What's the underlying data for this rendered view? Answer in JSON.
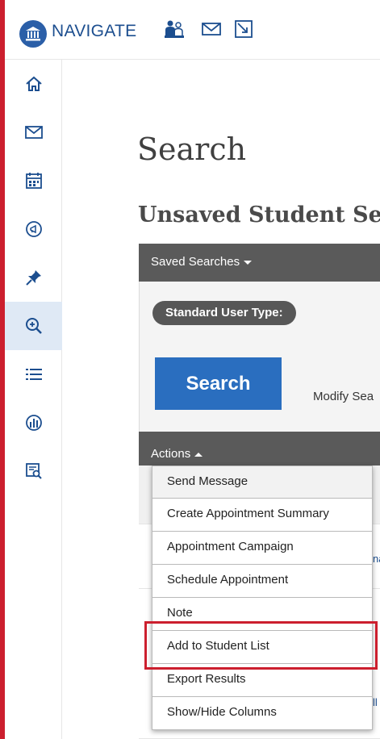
{
  "app": {
    "logo_text": "NAVIGATE"
  },
  "page": {
    "title": "Search",
    "subtitle": "Unsaved Student Se"
  },
  "saved_searches": {
    "label": "Saved Searches"
  },
  "filters": {
    "user_type_chip": "Standard User Type:"
  },
  "search_button": {
    "label": "Search"
  },
  "modify_link": {
    "label": "Modify Sea"
  },
  "actions": {
    "label": "Actions",
    "items": [
      "Send Message",
      "Create Appointment Summary",
      "Appointment Campaign",
      "Schedule Appointment",
      "Note",
      "Add to Student List",
      "Export Results",
      "Show/Hide Columns"
    ]
  },
  "background_rows": {
    "fragment_a": "na",
    "fragment_b": "ll"
  },
  "colors": {
    "brand_blue": "#2b5fa8",
    "search_button": "#2a6ebf",
    "dark_bar": "#5a5a5a",
    "highlight": "#cc1f2e",
    "sidebar_active": "#dfe9f5"
  }
}
